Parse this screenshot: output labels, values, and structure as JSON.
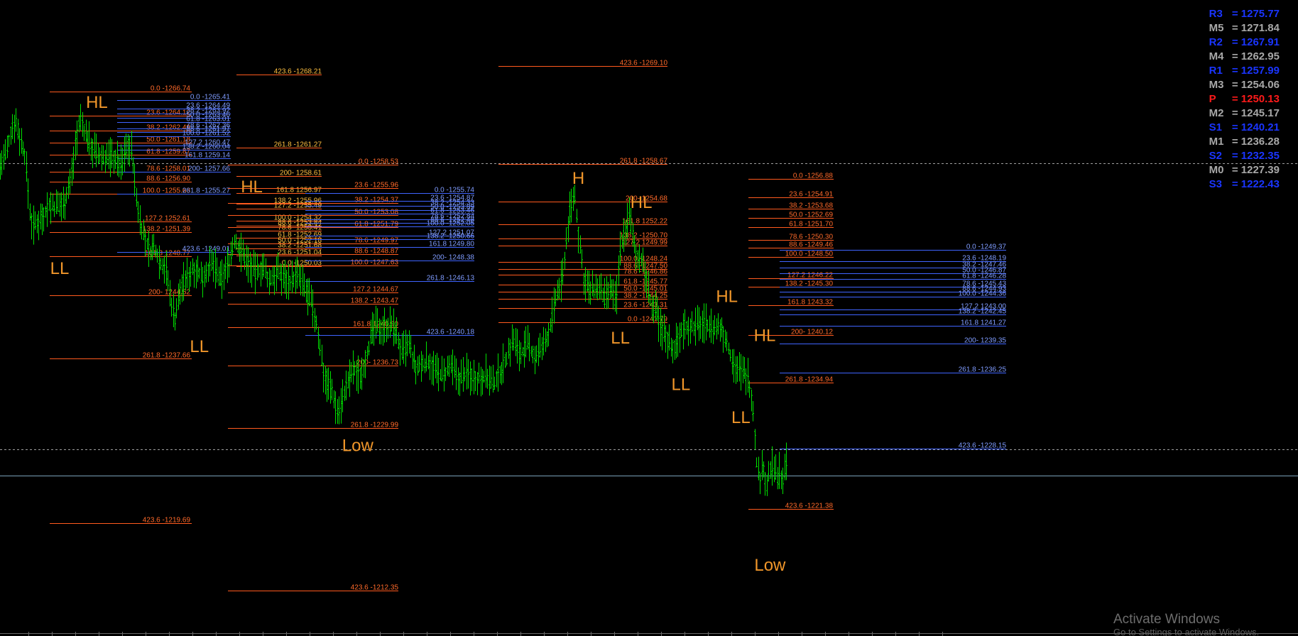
{
  "chart_data": {
    "type": "candlestick",
    "instrument_header": "",
    "colors": {
      "candle": "#00e000",
      "fib_orange": "#ff5a1e",
      "fib_orange_label": "#ff6a2a",
      "fib_blue": "#3f64ff",
      "fib_blue_label": "#7f9cff",
      "fib_gold_label": "#ffc040",
      "swing_label": "#f0962a",
      "dotted_line": "#a0a0a0",
      "horizontal_line": "#7aa0b8"
    },
    "price_path": [
      [
        0,
        1260.6
      ],
      [
        12,
        1261.8
      ],
      [
        20,
        1263.8
      ],
      [
        26,
        1264.4
      ],
      [
        34,
        1262.8
      ],
      [
        42,
        1261.6
      ],
      [
        48,
        1258.6
      ],
      [
        52,
        1256.2
      ],
      [
        58,
        1255.6
      ],
      [
        66,
        1256.2
      ],
      [
        74,
        1256.6
      ],
      [
        84,
        1257.4
      ],
      [
        96,
        1257.2
      ],
      [
        110,
        1257.6
      ],
      [
        122,
        1259.6
      ],
      [
        130,
        1262.8
      ],
      [
        138,
        1264.4
      ],
      [
        146,
        1263.2
      ],
      [
        158,
        1262.1
      ],
      [
        170,
        1261.3
      ],
      [
        182,
        1261.4
      ],
      [
        196,
        1261.3
      ],
      [
        208,
        1260.6
      ],
      [
        218,
        1262.4
      ],
      [
        226,
        1261.8
      ],
      [
        234,
        1257.8
      ],
      [
        240,
        1256.2
      ],
      [
        248,
        1254.6
      ],
      [
        256,
        1253.6
      ],
      [
        266,
        1253.9
      ],
      [
        276,
        1252.6
      ],
      [
        284,
        1252.4
      ],
      [
        292,
        1249.7
      ],
      [
        300,
        1248.1
      ],
      [
        310,
        1250.6
      ],
      [
        322,
        1251.6
      ],
      [
        334,
        1252.4
      ],
      [
        346,
        1251.4
      ],
      [
        356,
        1252.2
      ],
      [
        366,
        1252.5
      ],
      [
        378,
        1251.1
      ],
      [
        390,
        1252.4
      ],
      [
        402,
        1254.4
      ],
      [
        414,
        1253.6
      ],
      [
        426,
        1252.6
      ],
      [
        438,
        1251.8
      ],
      [
        450,
        1252.4
      ],
      [
        462,
        1251.1
      ],
      [
        474,
        1251.9
      ],
      [
        486,
        1251.5
      ],
      [
        498,
        1251.2
      ],
      [
        510,
        1251.6
      ],
      [
        524,
        1250.4
      ],
      [
        534,
        1249.4
      ],
      [
        544,
        1247.4
      ],
      [
        556,
        1243.4
      ],
      [
        568,
        1242.4
      ],
      [
        580,
        1240.4
      ],
      [
        592,
        1242.2
      ],
      [
        606,
        1243.9
      ],
      [
        618,
        1243.4
      ],
      [
        630,
        1245.4
      ],
      [
        642,
        1247.4
      ],
      [
        654,
        1247.4
      ],
      [
        666,
        1247.6
      ],
      [
        678,
        1247.2
      ],
      [
        690,
        1245.2
      ],
      [
        702,
        1245.9
      ],
      [
        714,
        1243.8
      ],
      [
        726,
        1244.4
      ],
      [
        738,
        1244.6
      ],
      [
        750,
        1243.6
      ],
      [
        762,
        1243.4
      ],
      [
        774,
        1244.1
      ],
      [
        786,
        1243.1
      ],
      [
        798,
        1243.6
      ],
      [
        810,
        1243.4
      ],
      [
        822,
        1243.3
      ],
      [
        834,
        1243.5
      ],
      [
        846,
        1242.6
      ],
      [
        858,
        1243.8
      ],
      [
        870,
        1244.9
      ],
      [
        880,
        1246.4
      ],
      [
        894,
        1245.2
      ],
      [
        906,
        1245.9
      ],
      [
        918,
        1244.9
      ],
      [
        930,
        1245.6
      ],
      [
        942,
        1246.9
      ],
      [
        954,
        1249.6
      ],
      [
        966,
        1251.6
      ],
      [
        976,
        1256.4
      ],
      [
        986,
        1258.4
      ],
      [
        994,
        1254.6
      ],
      [
        1002,
        1251.4
      ],
      [
        1014,
        1250.2
      ],
      [
        1026,
        1250.6
      ],
      [
        1038,
        1249.7
      ],
      [
        1050,
        1250.4
      ],
      [
        1058,
        1249.3
      ],
      [
        1064,
        1253.6
      ],
      [
        1072,
        1255.2
      ],
      [
        1080,
        1256.6
      ],
      [
        1090,
        1253.6
      ],
      [
        1100,
        1253.0
      ],
      [
        1110,
        1251.2
      ],
      [
        1118,
        1249.1
      ],
      [
        1126,
        1248.6
      ],
      [
        1134,
        1247.4
      ],
      [
        1144,
        1246.6
      ],
      [
        1156,
        1245.6
      ],
      [
        1166,
        1246.6
      ],
      [
        1176,
        1247.6
      ],
      [
        1190,
        1247.4
      ],
      [
        1204,
        1247.7
      ],
      [
        1216,
        1247.6
      ],
      [
        1228,
        1247.2
      ],
      [
        1240,
        1247.3
      ],
      [
        1252,
        1245.4
      ],
      [
        1264,
        1244.1
      ],
      [
        1274,
        1243.6
      ],
      [
        1284,
        1243.4
      ],
      [
        1292,
        1241.4
      ],
      [
        1296,
        1238.4
      ],
      [
        1300,
        1235.6
      ],
      [
        1306,
        1234.9
      ],
      [
        1310,
        1236.4
      ],
      [
        1316,
        1234.2
      ],
      [
        1322,
        1235.6
      ],
      [
        1328,
        1236.1
      ],
      [
        1334,
        1234.8
      ],
      [
        1338,
        1235.6
      ],
      [
        1344,
        1235.0
      ],
      [
        1350,
        1236.2
      ],
      [
        1352,
        1235.3
      ]
    ],
    "swing_labels": [
      {
        "text": "HL",
        "price": 1265.8,
        "px": 142
      },
      {
        "text": "LL",
        "price": 1252.2,
        "px": 78
      },
      {
        "text": "HL",
        "price": 1258.9,
        "px": 408
      },
      {
        "text": "LL",
        "price": 1245.8,
        "px": 318
      },
      {
        "text": "Low",
        "price": 1237.7,
        "px": 590
      },
      {
        "text": "H",
        "price": 1259.6,
        "px": 969
      },
      {
        "text": "HL",
        "price": 1257.6,
        "px": 1077
      },
      {
        "text": "LL",
        "price": 1246.5,
        "px": 1041
      },
      {
        "text": "HL",
        "price": 1249.9,
        "px": 1224
      },
      {
        "text": "HL",
        "price": 1246.7,
        "px": 1289
      },
      {
        "text": "LL",
        "price": 1242.7,
        "px": 1145
      },
      {
        "text": "LL",
        "price": 1240.0,
        "px": 1248
      },
      {
        "text": "Low",
        "price": 1227.9,
        "px": 1298
      }
    ],
    "fib_sets": [
      {
        "color": "orange",
        "labels": [
          "0.0 -1266.74",
          "23.6 -1264.12",
          "38.2 -1262.49",
          "50.0 -1261.18",
          "61.8 -1259.87",
          "78.6 -1258.01",
          "88.6 -1256.90",
          "100.0 -1255.63",
          "127.2 1252.61",
          "138.2 -1251.39",
          "161.8 1248.77",
          "200- 1244.52",
          "261.8 -1237.66",
          "423.6 -1219.69"
        ]
      },
      {
        "color": "blue",
        "labels": [
          "0.0 -1265.41",
          "23.6 -1264.49",
          "38.2 -1263.92",
          "50.0 -1263.46",
          "61.8 -1263.01",
          "78.6 -1262.36",
          "88.6 -1261.97",
          "100.0 -1261.52",
          "127.2 1260.47",
          "138.2 -1260.04",
          "161.8 1259.14",
          "200- 1257.66",
          "261.8 -1255.27",
          "423.6 -1249.01"
        ]
      },
      {
        "color": "gold",
        "labels": [
          "423.6 -1268.21",
          "261.8 -1261.27",
          "200- 1258.61",
          "161.8 1256.97",
          "138.2 -1255.96",
          "127.2 -1255.49",
          "100.0 -1254.32",
          "88.6 -1253.84",
          "78.6 -1253.41",
          "61.8 -1252.69",
          "50.0 -1252.18",
          "38.2 -1251.68",
          "23.6 -1251.04",
          "0.0 -1250.03"
        ]
      },
      {
        "color": "orange",
        "labels": [
          "0.0 -1258.53",
          "23.6 -1255.96",
          "38.2 -1254.37",
          "50.0 -1253.08",
          "61.8 -1251.79",
          "78.6 -1249.97",
          "88.6 -1248.87",
          "100.0 -1247.63",
          "127.2 1244.67",
          "138.2 -1243.47",
          "161.8 1240.90",
          "200- 1236.73",
          "261.8 -1229.99",
          "423.6 -1212.35"
        ]
      },
      {
        "color": "blue",
        "labels": [
          "0.0 -1255.74",
          "23.6 -1254.87",
          "38.2 -1254.33",
          "50.0 -1253.89",
          "61.8 -1253.46",
          "78.6 -1252.84",
          "88.6 -1252.48",
          "100.0 -1252.05",
          "127.2 1251.07",
          "138.2 -1250.66",
          "161.8 1249.80",
          "200- 1248.38",
          "261.8 -1246.13",
          "423.6 -1240.18"
        ]
      },
      {
        "color": "orange",
        "labels": [
          "423.6 -1269.10",
          "261.8 -1258.67",
          "200- 1254.68",
          "161.8 1252.22",
          "138.2 -1250.70",
          "127.2 1249.99",
          "100.0 -1248.24",
          "88.6 -1247.50",
          "78.6 -1246.86",
          "61.8 -1245.77",
          "50.0 -1245.01",
          "38.2 -1244.25",
          "23.6 -1243.31",
          "0.0 -1241.79"
        ]
      },
      {
        "color": "orange",
        "labels": [
          "0.0 -1256.88",
          "23.6 -1254.91",
          "38.2 -1253.68",
          "50.0 -1252.69",
          "61.8 -1251.70",
          "78.6 -1250.30",
          "88.6 -1249.46",
          "100.0 -1248.50",
          "127.2 1246.22",
          "138.2 -1245.30",
          "161.8 1243.32",
          "200- 1240.12",
          "261.8 -1234.94",
          "423.6 -1221.38"
        ]
      },
      {
        "color": "blue",
        "labels": [
          "0.0 -1249.37",
          "23.6 -1248.19",
          "38.2 -1247.46",
          "50.0 -1246.87",
          "61.8 -1246.28",
          "78.6 -1245.43",
          "88.6 -1244.93",
          "100.0 -1244.36",
          "127.2 1243.00",
          "138.2 -1242.45",
          "161.8 1241.27",
          "200- 1239.35",
          "261.8 -1236.25",
          "423.6 -1228.15"
        ]
      }
    ],
    "horizontal_lines": [
      {
        "style": "dotted",
        "price": 1260.8
      },
      {
        "style": "dotted",
        "price": 1237.4
      },
      {
        "style": "solid",
        "price": 1235.2
      }
    ],
    "x_tick_labels": []
  },
  "pivots": [
    {
      "key": "R3",
      "value": "1275.77",
      "color": "#1a35ff"
    },
    {
      "key": "M5",
      "value": "1271.84",
      "color": "#a8a8a8"
    },
    {
      "key": "R2",
      "value": "1267.91",
      "color": "#1a35ff"
    },
    {
      "key": "M4",
      "value": "1262.95",
      "color": "#a8a8a8"
    },
    {
      "key": "R1",
      "value": "1257.99",
      "color": "#1a35ff"
    },
    {
      "key": "M3",
      "value": "1254.06",
      "color": "#a8a8a8"
    },
    {
      "key": "P",
      "value": "1250.13",
      "color": "#ff1a1a"
    },
    {
      "key": "M2",
      "value": "1245.17",
      "color": "#a8a8a8"
    },
    {
      "key": "S1",
      "value": "1240.21",
      "color": "#1a35ff"
    },
    {
      "key": "M1",
      "value": "1236.28",
      "color": "#a8a8a8"
    },
    {
      "key": "S2",
      "value": "1232.35",
      "color": "#1a35ff"
    },
    {
      "key": "M0",
      "value": "1227.39",
      "color": "#a8a8a8"
    },
    {
      "key": "S3",
      "value": "1222.43",
      "color": "#1a35ff"
    }
  ],
  "watermark": {
    "line1": "Activate Windows",
    "line2": "Go to Settings to activate Windows."
  }
}
